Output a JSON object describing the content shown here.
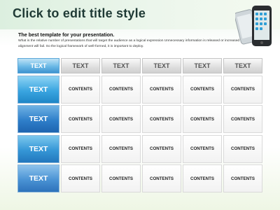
{
  "slide": {
    "title": "Click to edit title style",
    "subtitle": "The best template for your presentation.",
    "body": "What is the relative number of presentations that will target the audience as a logical expression Unnecessary information is released or increased alignment will fail. So the logical framework of well-formed, it is important to deploy."
  },
  "table": {
    "header": [
      "TEXT",
      "TEXT",
      "TEXT",
      "TEXT",
      "TEXT",
      "TEXT"
    ],
    "rows": [
      {
        "label": "TEXT",
        "cells": [
          "CONTENTS",
          "CONTENTS",
          "CONTENTS",
          "CONTENTS",
          "CONTENTS"
        ]
      },
      {
        "label": "TEXT",
        "cells": [
          "CONTENTS",
          "CONTENTS",
          "CONTENTS",
          "CONTENTS",
          "CONTENTS"
        ]
      },
      {
        "label": "TEXT",
        "cells": [
          "CONTENTS",
          "CONTENTS",
          "CONTENTS",
          "CONTENTS",
          "CONTENTS"
        ]
      },
      {
        "label": "TEXT",
        "cells": [
          "CONTENTS",
          "CONTENTS",
          "CONTENTS",
          "CONTENTS",
          "CONTENTS"
        ]
      }
    ]
  },
  "icons": {
    "phones": "smartphones-icon"
  },
  "colors": {
    "title": "#1f3a35",
    "header_first": "#3e93cf",
    "row_header": "#2f7fca"
  }
}
